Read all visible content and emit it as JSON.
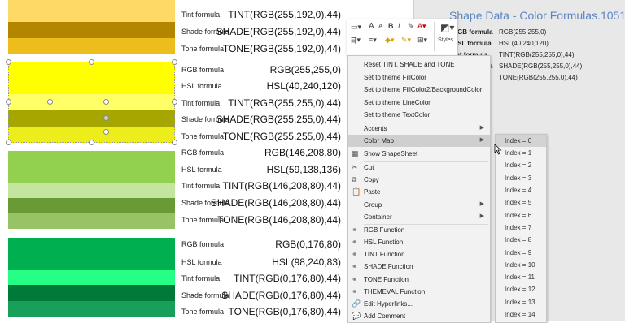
{
  "swatch_colors": {
    "tint_192": "#ffd966",
    "shade_192": "#b38600",
    "tone_192": "#edbd1c",
    "rgb_255": "#ffff00",
    "tint_255": "#ffff66",
    "shade_255": "#a6a600",
    "tone_255": "#eded1c",
    "rgb_146": "#92d050",
    "tint_146": "#c3e5a0",
    "shade_146": "#6a9a35",
    "tone_146": "#98c266",
    "rgb_176": "#00b050",
    "tint_176": "#26ff86",
    "shade_176": "#007a38",
    "tone_176": "#18a05a"
  },
  "rows": [
    {
      "label": "Tint formula",
      "formula": "TINT(RGB(255,192,0),44)"
    },
    {
      "label": "Shade formula",
      "formula": "SHADE(RGB(255,192,0),44)"
    },
    {
      "label": "Tone formula",
      "formula": "TONE(RGB(255,192,0),44)"
    },
    {
      "label": "RGB formula",
      "formula": "RGB(255,255,0)"
    },
    {
      "label": "HSL formula",
      "formula": "HSL(40,240,120)"
    },
    {
      "label": "Tint formula",
      "formula": "TINT(RGB(255,255,0),44)"
    },
    {
      "label": "Shade formula",
      "formula": "SHADE(RGB(255,255,0),44)"
    },
    {
      "label": "Tone formula",
      "formula": "TONE(RGB(255,255,0),44)"
    },
    {
      "label": "RGB formula",
      "formula": "RGB(146,208,80)"
    },
    {
      "label": "HSL formula",
      "formula": "HSL(59,138,136)"
    },
    {
      "label": "Tint formula",
      "formula": "TINT(RGB(146,208,80),44)"
    },
    {
      "label": "Shade formula",
      "formula": "SHADE(RGB(146,208,80),44)"
    },
    {
      "label": "Tone formula",
      "formula": "TONE(RGB(146,208,80),44)"
    },
    {
      "label": "RGB formula",
      "formula": "RGB(0,176,80)"
    },
    {
      "label": "HSL formula",
      "formula": "HSL(98,240,83)"
    },
    {
      "label": "Tint formula",
      "formula": "TINT(RGB(0,176,80),44)"
    },
    {
      "label": "Shade formula",
      "formula": "SHADE(RGB(0,176,80),44)"
    },
    {
      "label": "Tone formula",
      "formula": "TONE(RGB(0,176,80),44)"
    }
  ],
  "shape_data": {
    "title": "Shape Data - Color Formulas.1051",
    "rows": [
      {
        "key": "GB formula",
        "value": "RGB(255,255,0)"
      },
      {
        "key": "SL formula",
        "value": "HSL(40,240,120)"
      },
      {
        "key": "Tint formula",
        "value": "TINT(RGB(255,255,0),44)"
      },
      {
        "key": "a",
        "value": "SHADE(RGB(255,255,0),44)"
      },
      {
        "key": "",
        "value": "TONE(RGB(255,255,0),44)"
      }
    ]
  },
  "minibar": {
    "styles_label": "Styles",
    "font_a_large": "A",
    "font_a_small": "A"
  },
  "context_menu": {
    "items": [
      {
        "label": "Reset TINT, SHADE and TONE",
        "icon": "",
        "disabled": false
      },
      {
        "label": "Set to theme FillColor",
        "icon": "",
        "disabled": false
      },
      {
        "label": "Set to theme FillColor2/BackgroundColor",
        "icon": "",
        "disabled": false
      },
      {
        "label": "Set to theme LineColor",
        "icon": "",
        "disabled": false
      },
      {
        "label": "Set to theme TextColor",
        "icon": "",
        "disabled": false
      },
      {
        "label": "Accents",
        "icon": "",
        "disabled": false,
        "submenu": true
      },
      {
        "label": "Color Map",
        "icon": "",
        "disabled": false,
        "submenu": true
      },
      {
        "label": "Show ShapeSheet",
        "icon": "▦",
        "disabled": false
      },
      {
        "label": "Cut",
        "icon": "✂",
        "disabled": false
      },
      {
        "label": "Copy",
        "icon": "⧉",
        "disabled": false
      },
      {
        "label": "Paste",
        "icon": "📋",
        "disabled": false
      },
      {
        "label": "Group",
        "icon": "",
        "disabled": false,
        "submenu": true
      },
      {
        "label": "Container",
        "icon": "",
        "disabled": false,
        "submenu": true
      },
      {
        "label": "RGB Function",
        "icon": "⚭",
        "disabled": false
      },
      {
        "label": "HSL Function",
        "icon": "⚭",
        "disabled": false
      },
      {
        "label": "TINT Function",
        "icon": "⚭",
        "disabled": false
      },
      {
        "label": "SHADE Function",
        "icon": "⚭",
        "disabled": false
      },
      {
        "label": "TONE Function",
        "icon": "⚭",
        "disabled": false
      },
      {
        "label": "THEMEVAL Function",
        "icon": "⚭",
        "disabled": false
      },
      {
        "label": "Edit Hyperlinks...",
        "icon": "🔗",
        "disabled": false
      },
      {
        "label": "Add Comment",
        "icon": "💬",
        "disabled": false
      }
    ]
  },
  "color_map_submenu": {
    "items": [
      "Index = 0",
      "Index = 1",
      "Index = 2",
      "Index = 3",
      "Index = 4",
      "Index = 5",
      "Index = 6",
      "Index = 7",
      "Index = 8",
      "Index = 9",
      "Index = 10",
      "Index = 11",
      "Index = 12",
      "Index = 13",
      "Index = 14"
    ]
  }
}
